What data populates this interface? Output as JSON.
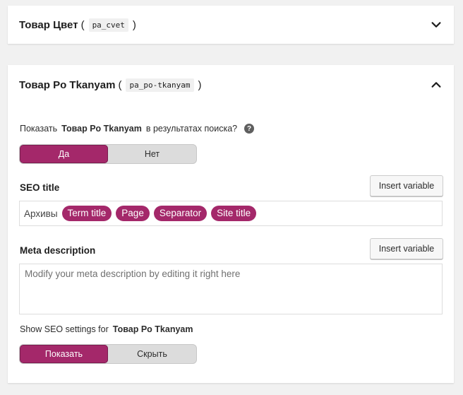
{
  "panel_cvet": {
    "title": "Товар Цвет",
    "slug": "pa_cvet",
    "open_paren": "(",
    "close_paren": ")"
  },
  "panel_tkanyam": {
    "title": "Товар Po Tkanyam",
    "slug": "pa_po-tkanyam",
    "open_paren": "(",
    "close_paren": ")",
    "search": {
      "label_prefix": "Показать",
      "label_term": "Товар Po Tkanyam",
      "label_suffix": "в результатах поиска?",
      "help": "?",
      "options": [
        "Да",
        "Нет"
      ],
      "selected": "Да"
    },
    "seo_title": {
      "label": "SEO title",
      "insert_label": "Insert variable",
      "prefix_text": "Архивы",
      "variables": [
        "Term title",
        "Page",
        "Separator",
        "Site title"
      ]
    },
    "meta_description": {
      "label": "Meta description",
      "insert_label": "Insert variable",
      "placeholder": "Modify your meta description by editing it right here"
    },
    "seo_settings": {
      "label_prefix": "Show SEO settings for",
      "label_term": "Товар Po Tkanyam",
      "options": [
        "Показать",
        "Скрыть"
      ],
      "selected": "Показать"
    }
  },
  "colors": {
    "accent": "#a4286a",
    "background": "#f1f1f1",
    "panel": "#ffffff"
  }
}
